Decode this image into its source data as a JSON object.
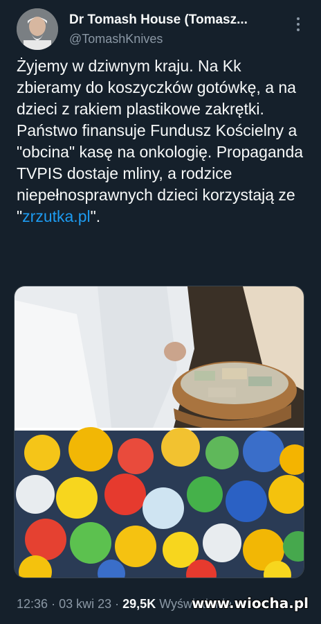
{
  "tweet": {
    "display_name": "Dr Tomash House (Tomasz...",
    "handle": "@TomashKnives",
    "text_part1": "Żyjemy w dziwnym kraju. Na Kk zbieramy do koszyczków gotówkę, a na dzieci z rakiem plastikowe zakrętki. Państwo finansuje Fundusz Kościelny a \"obcina\" kasę na onkologię. Propaganda TVPIS dostaje mliny, a rodzice niepełnosprawnych dzieci korzystają ze \"",
    "link_text": "zrzutka.pl",
    "text_part2": "\".",
    "time": "12:36",
    "date": "03 kwi 23",
    "views": "29,5K",
    "views_label": "Wyświetlenia"
  },
  "watermark": "www.wiocha.pl",
  "icons": {
    "more": "more-vertical-icon"
  },
  "colors": {
    "background": "#15202b",
    "link": "#1d9bf0",
    "secondary_text": "#8b98a5"
  }
}
